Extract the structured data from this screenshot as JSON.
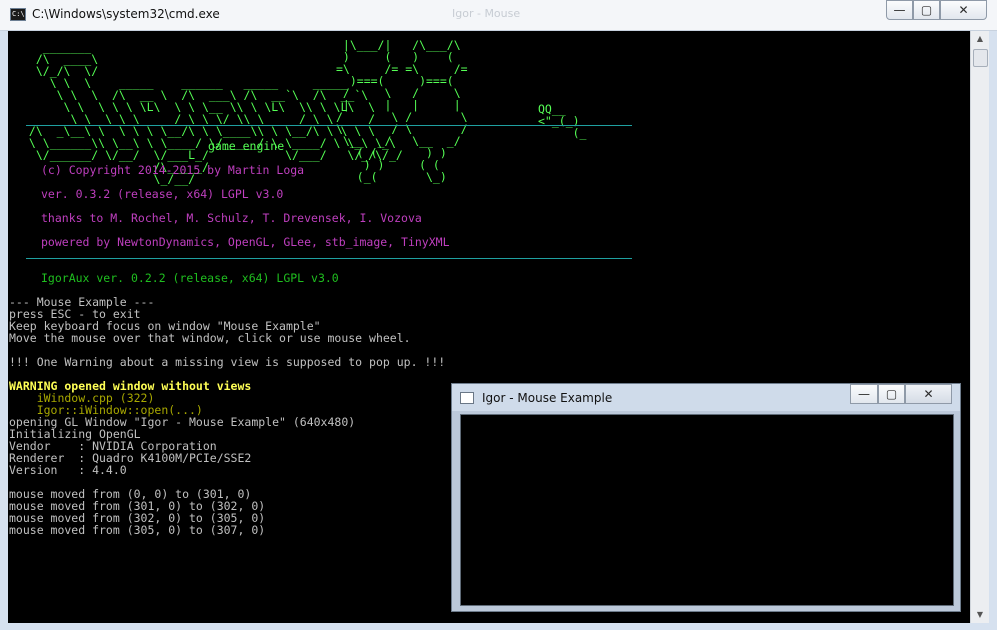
{
  "cmd_window": {
    "title": "C:\\Windows\\system32\\cmd.exe",
    "ghost_title": "Igor - Mouse",
    "icon_label": "C:\\",
    "buttons": {
      "minimize": "—",
      "maximize": "▢",
      "close": "✕"
    }
  },
  "console": {
    "logo": {
      "left": "   _______\n  /\\  ____\\\n  \\/_/\\  \\/\n    \\ \\  \\    _____    ______   _____     _____\n     \\ \\  \\  /\\  __ \\  /\\  ___\\ /\\  __`\\  /\\  __`\\\n      \\ \\  \\ \\ \\ \\L\\  \\ \\ \\__ \\\\ \\ \\L\\  \\\\ \\ \\L\\  \\\n  ____ \\ \\  \\ \\ \\  __ / \\ \\ \\/_\\\\ \\  __ / \\ \\  __ /\n /\\  _\\__\\ \\  \\ \\ \\ \\__/\\ \\ \\____\\\\ \\ \\__/\\ \\ \\ \\ \\\n \\ \\______\\\\ \\__\\ \\ \\____/ \\/_____/ \\ \\____/ \\ \\_\\ \\_\\\n  \\/______/ \\/__/  \\/___L_/           \\/___/   \\/_/\\/_/\n                   /\\_____/\n                   \\_/__/",
      "cats": " |\\___/|   /\\___/\\\n )     (   )    (\n=\\     /= =\\     /=\n  )===(     )===(\n /     \\   /     \\\n |     |   |     |\n/       \\ /       \\\n\\       / \\       /\n \\__  _/   \\__  _/\n   ( (       ) )\n    ) )     ( (\n   (_(       \\_)",
      "mouse": "QQ__\n<\"_(_)\n     (_"
    },
    "engine_label": "game engine",
    "info": {
      "copyright": "(c) Copyright 2014-2015 by Martin Loga",
      "version": "ver. 0.3.2 (release, x64) LGPL v3.0",
      "thanks": "thanks to M. Rochel, M. Schulz, T. Drevensek, I. Vozova",
      "powered": "powered by NewtonDynamics, OpenGL, GLee, stb_image, TinyXML",
      "aux": "IgorAux ver. 0.2.2 (release, x64) LGPL v3.0"
    },
    "example": {
      "header": "--- Mouse Example ---",
      "esc": "press ESC - to exit",
      "focus": "Keep keyboard focus on window \"Mouse Example\"",
      "move": "Move the mouse over that window, click or use mouse wheel.",
      "notice": "!!! One Warning about a missing view is supposed to pop up. !!!"
    },
    "warning": {
      "text": "WARNING opened window without views",
      "file": "    iWindow.cpp (322)",
      "func": "    Igor::iWindow::open(...)"
    },
    "gl": {
      "opening": "opening GL Window \"Igor - Mouse Example\" (640x480)",
      "init": "Initializing OpenGL",
      "vendor": "Vendor    : NVIDIA Corporation",
      "renderer": "Renderer  : Quadro K4100M/PCIe/SSE2",
      "version": "Version   : 4.4.0"
    },
    "mouse_log": [
      "mouse moved from (0, 0) to (301, 0)",
      "mouse moved from (301, 0) to (302, 0)",
      "mouse moved from (302, 0) to (305, 0)",
      "mouse moved from (305, 0) to (307, 0)"
    ]
  },
  "scrollbar": {
    "up": "▲",
    "down": "▼"
  },
  "igor_window": {
    "title": "Igor - Mouse Example",
    "buttons": {
      "minimize": "—",
      "maximize": "▢",
      "close": "✕"
    }
  },
  "colors": {
    "console_bg": "#000000",
    "logo_green": "#55ff55",
    "info_purple": "#bf3fbf",
    "aux_green": "#1fbf1f",
    "warning_yellow": "#ffff55",
    "trace_olive": "#a8a800",
    "rule_teal": "#1fa0a0"
  }
}
